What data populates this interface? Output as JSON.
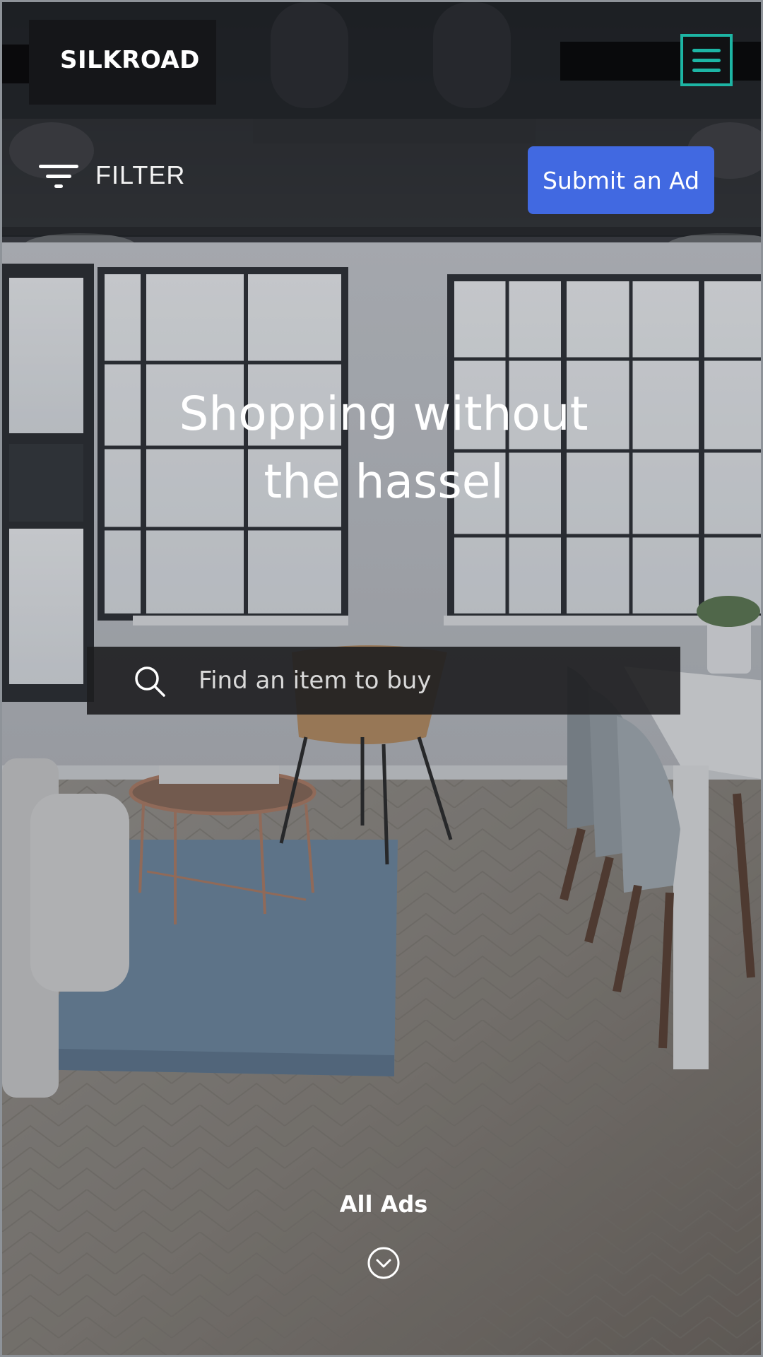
{
  "brand": {
    "name": "SILKROAD"
  },
  "header": {
    "menu_icon": "hamburger-menu-icon",
    "accent_color": "#1db5a4"
  },
  "toolbar": {
    "filter_label": "FILTER",
    "filter_icon": "filter-lines-icon",
    "submit_label": "Submit an Ad",
    "submit_color": "#4169e1"
  },
  "hero": {
    "title_line1": "Shopping without",
    "title_line2": "the hassel",
    "background": "loft-interior-photo"
  },
  "search": {
    "placeholder": "Find an item to buy",
    "icon": "search-icon"
  },
  "footer": {
    "all_ads_label": "All Ads",
    "scroll_icon": "chevron-down-circle-icon"
  }
}
